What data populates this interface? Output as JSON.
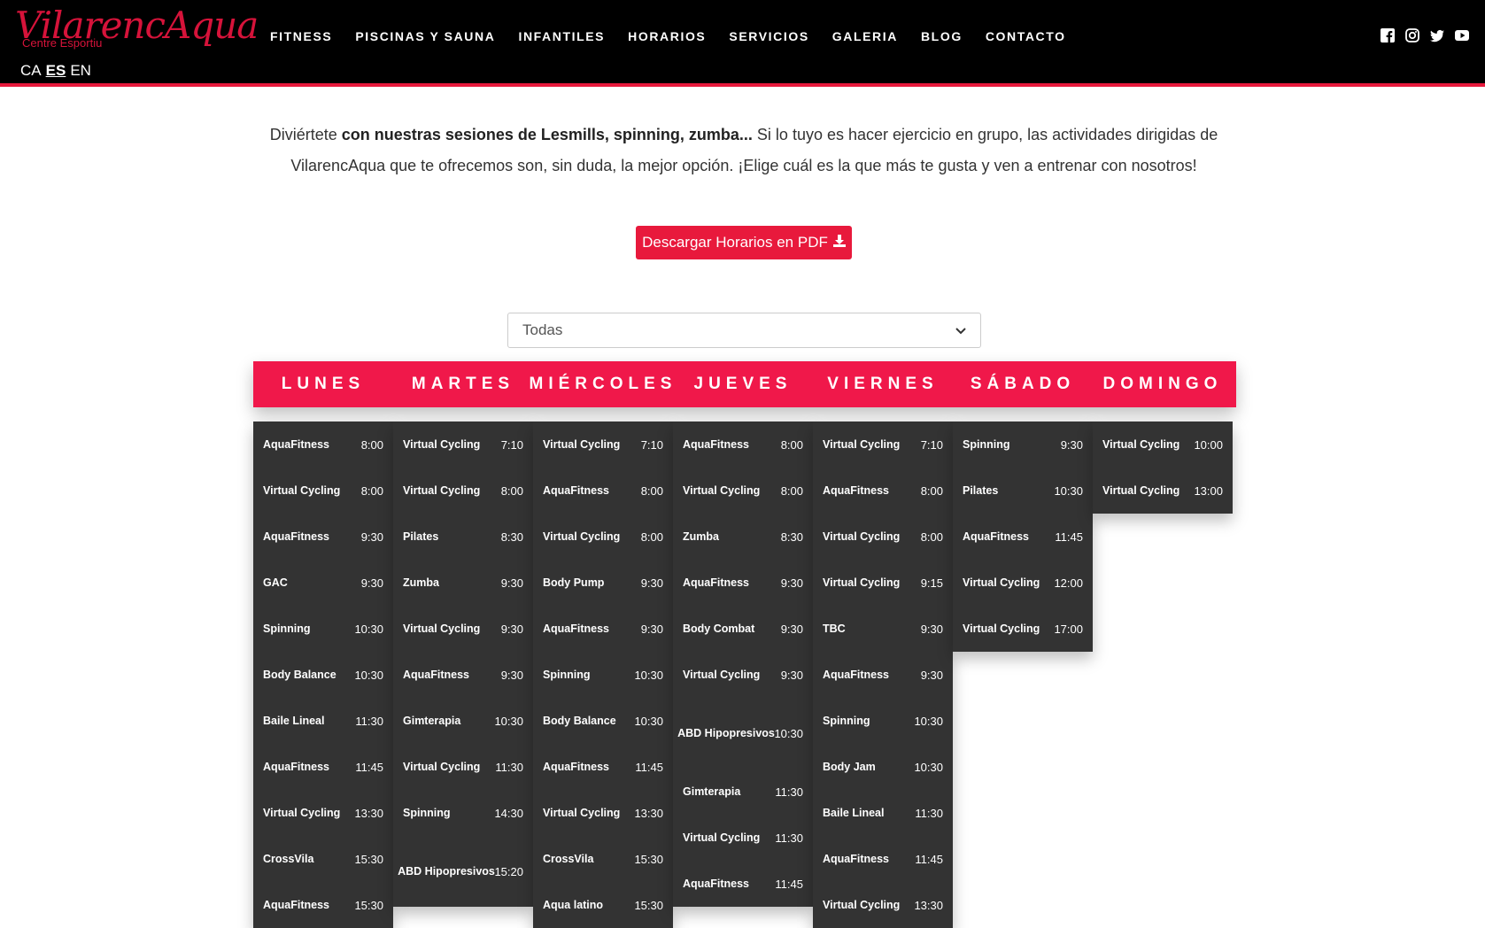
{
  "header": {
    "logo_main": "VilarencAqua",
    "logo_sub": "Centre Esportiu",
    "languages": [
      "CA",
      "ES",
      "EN"
    ],
    "nav": [
      "FITNESS",
      "PISCINAS Y SAUNA",
      "INFANTILES",
      "HORARIOS",
      "SERVICIOS",
      "GALERIA",
      "BLOG",
      "CONTACTO"
    ],
    "social_icons": [
      "facebook-icon",
      "instagram-icon",
      "twitter-icon",
      "youtube-icon"
    ]
  },
  "intro": {
    "text_start": "Diviértete ",
    "text_bold": "con nuestras sesiones de Lesmills, spinning, zumba...",
    "text_rest": " Si lo tuyo es hacer ejercicio en grupo, las actividades dirigidas de VilarencAqua que te ofrecemos son, sin duda, la mejor opción. ¡Elige cuál es la que más te gusta y ven a entrenar con nosotros!"
  },
  "pdf_button": "Descargar Horarios en PDF",
  "filter": {
    "selected": "Todas"
  },
  "colors": {
    "accent": "#e8193c",
    "bar": "#f0184a",
    "cell": "#333333"
  },
  "days": [
    "LUNES",
    "MARTES",
    "MIÉRCOLES",
    "JUEVES",
    "VIERNES",
    "SÁBADO",
    "DOMINGO"
  ],
  "schedule": [
    [
      {
        "name": "AquaFitness",
        "time": "8:00"
      },
      {
        "name": "Virtual Cycling",
        "time": "8:00"
      },
      {
        "name": "AquaFitness",
        "time": "9:30"
      },
      {
        "name": "GAC",
        "time": "9:30"
      },
      {
        "name": "Spinning",
        "time": "10:30"
      },
      {
        "name": "Body Balance",
        "time": "10:30"
      },
      {
        "name": "Baile Lineal",
        "time": "11:30"
      },
      {
        "name": "AquaFitness",
        "time": "11:45"
      },
      {
        "name": "Virtual Cycling",
        "time": "13:30"
      },
      {
        "name": "CrossVila",
        "time": "15:30"
      },
      {
        "name": "AquaFitness",
        "time": "15:30"
      }
    ],
    [
      {
        "name": "Virtual Cycling",
        "time": "7:10"
      },
      {
        "name": "Virtual Cycling",
        "time": "8:00"
      },
      {
        "name": "Pilates",
        "time": "8:30"
      },
      {
        "name": "Zumba",
        "time": "9:30"
      },
      {
        "name": "Virtual Cycling",
        "time": "9:30"
      },
      {
        "name": "AquaFitness",
        "time": "9:30"
      },
      {
        "name": "Gimterapia",
        "time": "10:30"
      },
      {
        "name": "Virtual Cycling",
        "time": "11:30"
      },
      {
        "name": "Spinning",
        "time": "14:30"
      },
      {
        "name": "ABD Hipopresivos",
        "time": "15:20",
        "tall": true
      }
    ],
    [
      {
        "name": "Virtual Cycling",
        "time": "7:10"
      },
      {
        "name": "AquaFitness",
        "time": "8:00"
      },
      {
        "name": "Virtual Cycling",
        "time": "8:00"
      },
      {
        "name": "Body Pump",
        "time": "9:30"
      },
      {
        "name": "AquaFitness",
        "time": "9:30"
      },
      {
        "name": "Spinning",
        "time": "10:30"
      },
      {
        "name": "Body Balance",
        "time": "10:30"
      },
      {
        "name": "AquaFitness",
        "time": "11:45"
      },
      {
        "name": "Virtual Cycling",
        "time": "13:30"
      },
      {
        "name": "CrossVila",
        "time": "15:30"
      },
      {
        "name": "Aqua latino",
        "time": "15:30"
      }
    ],
    [
      {
        "name": "AquaFitness",
        "time": "8:00"
      },
      {
        "name": "Virtual Cycling",
        "time": "8:00"
      },
      {
        "name": "Zumba",
        "time": "8:30"
      },
      {
        "name": "AquaFitness",
        "time": "9:30"
      },
      {
        "name": "Body Combat",
        "time": "9:30"
      },
      {
        "name": "Virtual Cycling",
        "time": "9:30"
      },
      {
        "name": "ABD Hipopresivos",
        "time": "10:30",
        "tall": true
      },
      {
        "name": "Gimterapia",
        "time": "11:30"
      },
      {
        "name": "Virtual Cycling",
        "time": "11:30"
      },
      {
        "name": "AquaFitness",
        "time": "11:45"
      }
    ],
    [
      {
        "name": "Virtual Cycling",
        "time": "7:10"
      },
      {
        "name": "AquaFitness",
        "time": "8:00"
      },
      {
        "name": "Virtual Cycling",
        "time": "8:00"
      },
      {
        "name": "Virtual Cycling",
        "time": "9:15"
      },
      {
        "name": "TBC",
        "time": "9:30"
      },
      {
        "name": "AquaFitness",
        "time": "9:30"
      },
      {
        "name": "Spinning",
        "time": "10:30"
      },
      {
        "name": "Body Jam",
        "time": "10:30"
      },
      {
        "name": "Baile Lineal",
        "time": "11:30"
      },
      {
        "name": "AquaFitness",
        "time": "11:45"
      },
      {
        "name": "Virtual Cycling",
        "time": "13:30"
      }
    ],
    [
      {
        "name": "Spinning",
        "time": "9:30"
      },
      {
        "name": "Pilates",
        "time": "10:30"
      },
      {
        "name": "AquaFitness",
        "time": "11:45"
      },
      {
        "name": "Virtual Cycling",
        "time": "12:00"
      },
      {
        "name": "Virtual Cycling",
        "time": "17:00"
      }
    ],
    [
      {
        "name": "Virtual Cycling",
        "time": "10:00"
      },
      {
        "name": "Virtual Cycling",
        "time": "13:00"
      }
    ]
  ]
}
